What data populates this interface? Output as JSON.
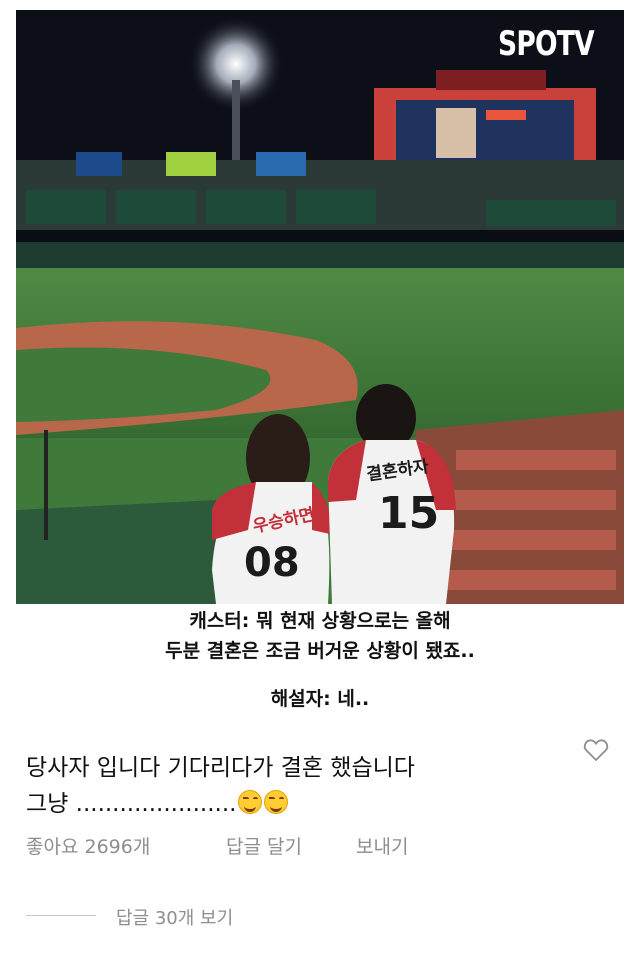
{
  "image": {
    "watermark": "SPOTV",
    "jersey_left": {
      "name": "우승하면",
      "number": "08"
    },
    "jersey_right": {
      "name": "결혼하자",
      "number": "15"
    }
  },
  "caption": {
    "line1": "캐스터: 뭐 현재 상황으로는 올해",
    "line2": "두분  결혼은 조금 버거운 상황이 됐죠..",
    "line3": "해설자: 네.."
  },
  "comment": {
    "line1": "당사자 입니다 기다리다가 결혼 했습니다",
    "line2": "그냥 ......................",
    "emoji_count": 2
  },
  "actions": {
    "likes": "좋아요 2696개",
    "reply": "답글 달기",
    "send": "보내기"
  },
  "replies": {
    "view": "답글 30개 보기"
  },
  "colors": {
    "field_green": "#3f7a3a",
    "dirt": "#b9674a",
    "jersey_red": "#c2303a"
  }
}
